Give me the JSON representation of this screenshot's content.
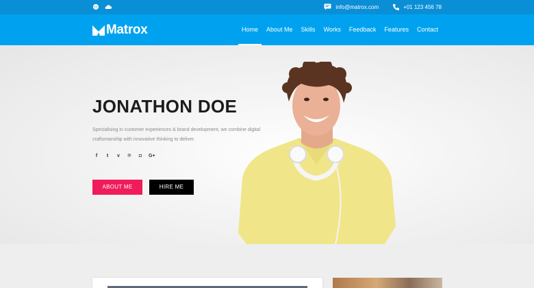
{
  "topbar": {
    "email": "info@matrox.com",
    "phone": "+01 123 456 78",
    "left_icons": [
      "github-icon",
      "cloud-icon"
    ]
  },
  "brand": {
    "name": "Matrox"
  },
  "nav": {
    "items": [
      {
        "label": "Home",
        "active": true
      },
      {
        "label": "About Me"
      },
      {
        "label": "Skills"
      },
      {
        "label": "Works"
      },
      {
        "label": "Feedback"
      },
      {
        "label": "Features"
      },
      {
        "label": "Contact"
      }
    ]
  },
  "hero": {
    "name": "JONATHON DOE",
    "description": "Specialising in customer experiences & brand development, we combine digital craftsmanship with innovative thinking to deliver.",
    "social": [
      {
        "icon": "facebook-icon",
        "glyph": "f"
      },
      {
        "icon": "twitter-icon",
        "glyph": "t"
      },
      {
        "icon": "vimeo-icon",
        "glyph": "v"
      },
      {
        "icon": "pinterest-icon",
        "glyph": "℗"
      },
      {
        "icon": "instagram-icon",
        "glyph": "◘"
      },
      {
        "icon": "google-plus-icon",
        "glyph": "G+"
      }
    ],
    "buttons": {
      "about": "ABOUT ME",
      "hire": "HIRE ME"
    }
  },
  "colors": {
    "topbar": "#0a8fd6",
    "nav": "#00a2ef",
    "accent": "#f01b5b",
    "dark_button": "#000000"
  }
}
